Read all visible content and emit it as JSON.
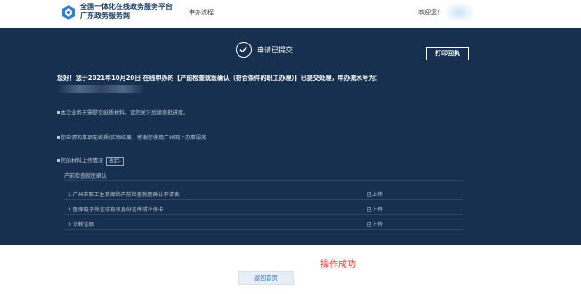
{
  "header": {
    "site_name_line1": "全国一体化在线政务服务平台",
    "site_name_line2": "广东政务服务网",
    "nav_process": "申办流程",
    "welcome": "欢迎您！"
  },
  "result": {
    "title": "申请已提交",
    "print_label": "打印回执",
    "intro": "您好！您于2021年10月20日 在线申办的【产前检查就医确认（符合条件的职工办理）】已提交处理，申办流水号为：",
    "notes": [
      "本次业务无需提交纸质材料，请您关注后续审批进度。",
      "您申请的事项无纸质/实物结果，感谢您使用广州网上办事服务",
      "您的材料上传情况"
    ],
    "collapse_label": "收起-",
    "materials_section": "产前检查就医确认",
    "materials": [
      {
        "name": "1.广州市职工生育保险产前检查就医确认申请表",
        "status": "已上传"
      },
      {
        "name": "2.医保电子凭证或有效身份证件或社保卡",
        "status": "已上传"
      },
      {
        "name": "3.诊断证明",
        "status": "已上传"
      }
    ]
  },
  "footer": {
    "success_text": "操作成功",
    "back_home": "返回首页"
  }
}
